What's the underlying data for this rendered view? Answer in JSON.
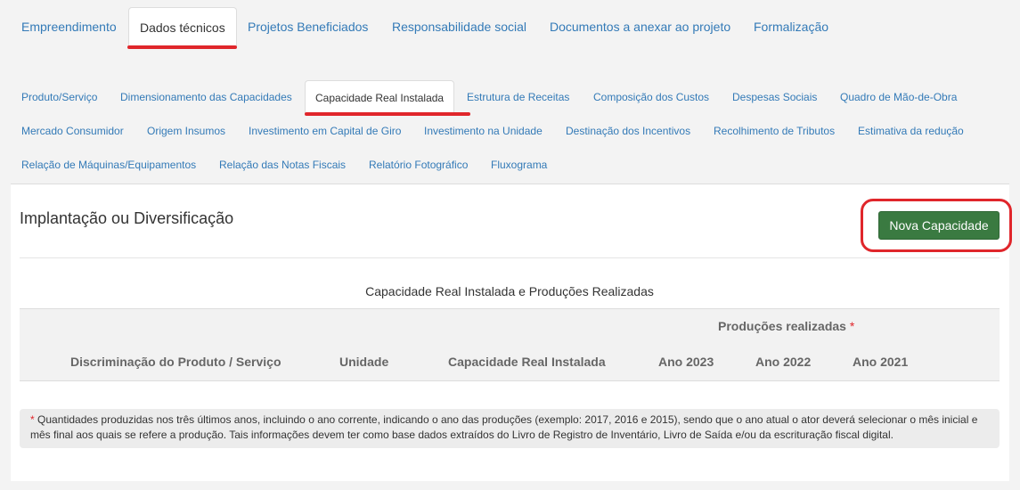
{
  "top_tabs": [
    {
      "label": "Empreendimento"
    },
    {
      "label": "Dados técnicos"
    },
    {
      "label": "Projetos Beneficiados"
    },
    {
      "label": "Responsabilidade social"
    },
    {
      "label": "Documentos a anexar ao projeto"
    },
    {
      "label": "Formalização"
    }
  ],
  "sub_tabs": [
    {
      "label": "Produto/Serviço"
    },
    {
      "label": "Dimensionamento das Capacidades"
    },
    {
      "label": "Capacidade Real Instalada"
    },
    {
      "label": "Estrutura de Receitas"
    },
    {
      "label": "Composição dos Custos"
    },
    {
      "label": "Despesas Sociais"
    },
    {
      "label": "Quadro de Mão-de-Obra"
    },
    {
      "label": "Mercado Consumidor"
    },
    {
      "label": "Origem Insumos"
    },
    {
      "label": "Investimento em Capital de Giro"
    },
    {
      "label": "Investimento na Unidade"
    },
    {
      "label": "Destinação dos Incentivos"
    },
    {
      "label": "Recolhimento de Tributos"
    },
    {
      "label": "Estimativa da redução"
    },
    {
      "label": "Relação de Máquinas/Equipamentos"
    },
    {
      "label": "Relação das Notas Fiscais"
    },
    {
      "label": "Relatório Fotográfico"
    },
    {
      "label": "Fluxograma"
    }
  ],
  "panel": {
    "title": "Implantação ou Diversificação",
    "new_button": "Nova Capacidade",
    "table": {
      "caption": "Capacidade Real Instalada e Produções Realizadas",
      "group_header": "Produções realizadas",
      "required_mark": "*",
      "columns": [
        "Discriminação do Produto / Serviço",
        "Unidade",
        "Capacidade Real Instalada",
        "Ano 2023",
        "Ano 2022",
        "Ano 2021"
      ]
    },
    "note_mark": "*",
    "note_text": "Quantidades produzidas nos três últimos anos, incluindo o ano corrente, indicando o ano das produções (exemplo: 2017, 2016 e 2015), sendo que o ano atual o ator deverá selecionar o mês inicial e mês final aos quais se refere a produção. Tais informações devem ter como base dados extraídos do Livro de Registro de Inventário, Livro de Saída e/ou da escrituração fiscal digital."
  },
  "colors": {
    "accent": "#337ab7",
    "button": "#3a7a41",
    "highlight": "#e0262b"
  }
}
